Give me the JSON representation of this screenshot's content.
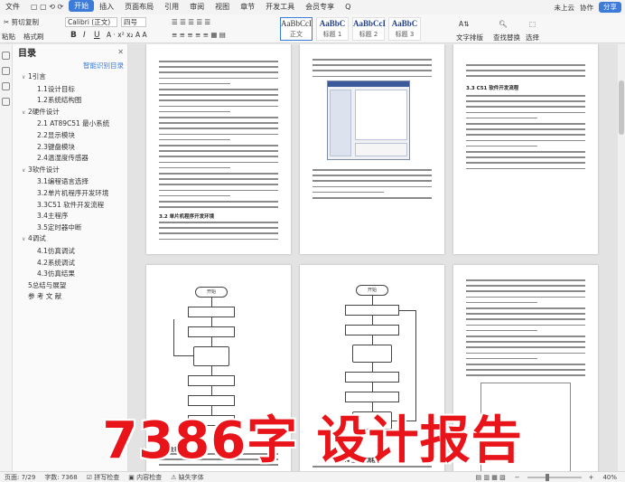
{
  "menu": {
    "file": "文件",
    "items": [
      "开始",
      "插入",
      "页面布局",
      "引用",
      "审阅",
      "视图",
      "章节",
      "开发工具",
      "会员专享"
    ],
    "active_index": 0,
    "search": "Q",
    "cloud": "未上云",
    "collab": "协作",
    "share": "分享"
  },
  "ribbon": {
    "cut": "剪切",
    "copy": "复制",
    "paste": "粘贴",
    "format_painter": "格式刷",
    "font_name": "Calibri (正文)",
    "font_size": "四号",
    "bold": "B",
    "italic": "I",
    "underline": "U",
    "styles": [
      {
        "sample": "AaBbCcI",
        "name": "正文"
      },
      {
        "sample": "AaBbC",
        "name": "标题 1"
      },
      {
        "sample": "AaBbCcI",
        "name": "标题 2"
      },
      {
        "sample": "AaBbC",
        "name": "标题 3"
      }
    ],
    "text_layout": "文字排版",
    "find_replace": "查找替换",
    "select": "选择"
  },
  "toc": {
    "title": "目录",
    "smart": "智能识别目录",
    "items": [
      {
        "level": 1,
        "text": "1引言",
        "caret": true
      },
      {
        "level": 2,
        "text": "1.1设计目标"
      },
      {
        "level": 2,
        "text": "1.2系统结构图"
      },
      {
        "level": 1,
        "text": "2硬件设计",
        "caret": true
      },
      {
        "level": 2,
        "text": "2.1  AT89C51 最小系统"
      },
      {
        "level": 2,
        "text": "2.2显示模块"
      },
      {
        "level": 2,
        "text": "2.3键盘模块"
      },
      {
        "level": 2,
        "text": "2.4温湿度传感器"
      },
      {
        "level": 1,
        "text": "3软件设计",
        "caret": true
      },
      {
        "level": 2,
        "text": "3.1编程语言选择"
      },
      {
        "level": 2,
        "text": "3.2单片机程序开发环境"
      },
      {
        "level": 2,
        "text": "3.3C51 软件开发流程"
      },
      {
        "level": 2,
        "text": "3.4主程序"
      },
      {
        "level": 2,
        "text": "3.5定时器中断"
      },
      {
        "level": 1,
        "text": "4调试",
        "caret": true
      },
      {
        "level": 2,
        "text": "4.1仿真调试"
      },
      {
        "level": 2,
        "text": "4.2系统调试"
      },
      {
        "level": 2,
        "text": "4.3仿真结果"
      },
      {
        "level": 1,
        "text": "5总结与展望"
      },
      {
        "level": 1,
        "text": "参 考 文 献"
      }
    ]
  },
  "pages": {
    "p1_heading": "3.2 单片机程序开发环境",
    "p3_heading": "3.3 C51 软件开发流程",
    "p4_label": "开始",
    "p6_label": "开始",
    "p4_caption": "3.4 主程序",
    "p6_caption": "图3.4 主程序流程图"
  },
  "overlay": "7386字 设计报告",
  "status": {
    "page": "页面: 7/29",
    "words": "字数: 7368",
    "spell": "拼写检查",
    "content_check": "内容检查",
    "missing_font": "缺失字体",
    "zoom": "40%"
  }
}
